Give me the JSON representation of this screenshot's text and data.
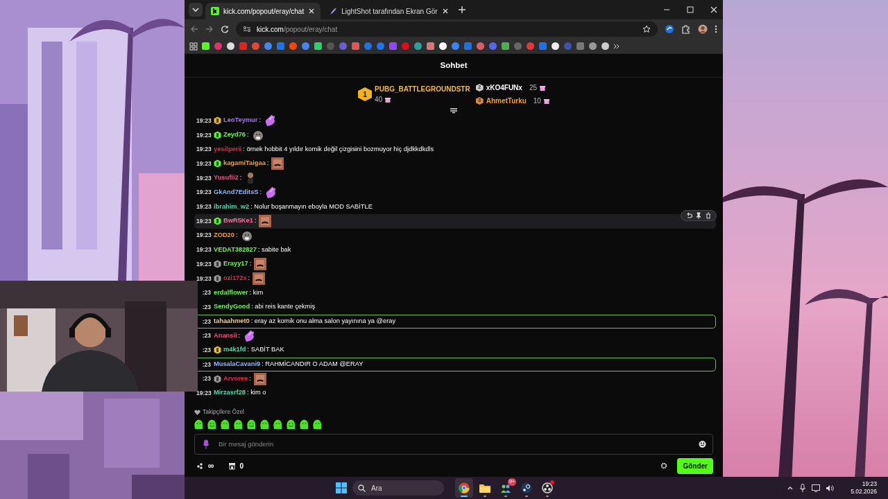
{
  "browser": {
    "tabs": [
      {
        "title": "kick.com/popout/eray/chat",
        "selected": true
      },
      {
        "title": "LightShot tarafından Ekran Gör",
        "selected": false
      }
    ],
    "address": {
      "host": "kick.com",
      "path": "/popout/eray/chat"
    }
  },
  "chat": {
    "title": "Sohbet",
    "leaderboard": [
      {
        "rank": "1",
        "user": "PUBG_BATTLEGROUNDSTR",
        "count": "40",
        "color": "#f5b94a"
      },
      {
        "rank": "2",
        "user": "xKO4FUNx",
        "count": "25",
        "color": "#ffffff"
      },
      {
        "rank": "3",
        "user": "AhmetTurku",
        "count": "10",
        "color": "#f59e2c"
      }
    ],
    "messages": [
      {
        "time": "19:23",
        "badge": {
          "kind": "gold"
        },
        "user": "LeoTeymur",
        "color": "#a970ff",
        "text": ":",
        "emote": {
          "kind": "hand"
        },
        "highlighted": false,
        "hovered": false
      },
      {
        "time": "19:23",
        "badge": {
          "kind": "green"
        },
        "user": "Zeyd76",
        "color": "#72f25b",
        "text": ":",
        "emote": {
          "kind": "seal"
        },
        "highlighted": false,
        "hovered": false
      },
      {
        "time": "19:23",
        "user": "yesilperii",
        "color": "#e0284b",
        "text": ": örnek hobbit 4 yıldır komik değil çizgisini bozmuyor hiç djdkkdkdls",
        "highlighted": false,
        "hovered": false
      },
      {
        "time": "19:23",
        "badge": {
          "kind": "green"
        },
        "user": "kagamiTaigaa",
        "color": "#f59e2c",
        "text": ":",
        "emote": {
          "kind": "face"
        },
        "highlighted": false,
        "hovered": false
      },
      {
        "time": "19:23",
        "user": "Yusufii2",
        "color": "#e05a8a",
        "text": ":",
        "emote": {
          "kind": "figure"
        },
        "highlighted": false,
        "hovered": false
      },
      {
        "time": "19:23",
        "user": "GkAnd7EditsS",
        "color": "#8fb4ff",
        "text": ":",
        "emote": {
          "kind": "hand"
        },
        "highlighted": false,
        "hovered": false
      },
      {
        "time": "19:23",
        "user": "ibrahim_w2",
        "color": "#5ad8b0",
        "text": ": Nolur boşanmayın eboyla MOD SABİTLE",
        "highlighted": false,
        "hovered": false
      },
      {
        "time": "19:23",
        "badge": {
          "kind": "green"
        },
        "user": "BwR5Ke1",
        "color": "#ff6b9a",
        "text": ":",
        "emote": {
          "kind": "face"
        },
        "highlighted": false,
        "hovered": true
      },
      {
        "time": "19:23",
        "user": "ZOD20",
        "color": "#f59e2c",
        "text": ":",
        "emote": {
          "kind": "seal"
        },
        "highlighted": false,
        "hovered": false
      },
      {
        "time": "19:23",
        "user": "VEDAT382827",
        "color": "#72f25b",
        "text": ": sabite bak",
        "highlighted": false,
        "hovered": false
      },
      {
        "time": "19:23",
        "badge": {
          "kind": "gray"
        },
        "user": "Erayy17",
        "color": "#72f25b",
        "text": ":",
        "emote": {
          "kind": "face"
        },
        "highlighted": false,
        "hovered": false
      },
      {
        "time": "19:23",
        "badge": {
          "kind": "gray"
        },
        "user": "ozi172x",
        "color": "#e0284b",
        "text": ":",
        "emote": {
          "kind": "face"
        },
        "highlighted": false,
        "hovered": false
      },
      {
        "time": ":23",
        "user": "erdalflower",
        "color": "#72f25b",
        "text": ": kim",
        "highlighted": false,
        "hovered": false
      },
      {
        "time": ":23",
        "user": "SendyGood",
        "color": "#72f25b",
        "text": ": abi reis kante çekmiş",
        "highlighted": false,
        "hovered": false
      },
      {
        "time": ":23",
        "user": "tahaahmet0",
        "color": "#f3c98b",
        "text": ": eray az komik onu alma salon yayınına ya @eray",
        "highlighted": true,
        "hovered": false
      },
      {
        "time": ":23",
        "user": "Anansii",
        "color": "#e8507a",
        "text": ":",
        "emote": {
          "kind": "hand"
        },
        "highlighted": false,
        "hovered": false
      },
      {
        "time": ":23",
        "badge": {
          "kind": "yellow"
        },
        "user": "m4k1fd",
        "color": "#5ad8b0",
        "text": ": SABİT BAK",
        "highlighted": false,
        "hovered": false
      },
      {
        "time": ":23",
        "user": "MusalaCavani9",
        "color": "#8fb4ff",
        "text": ": RAHMİCANDIR O ADAM @ERAY",
        "highlighted": true,
        "hovered": false
      },
      {
        "time": ":23",
        "badge": {
          "kind": "gray"
        },
        "user": "Arvoree",
        "color": "#e0284b",
        "text": ":",
        "emote": {
          "kind": "face"
        },
        "highlighted": false,
        "hovered": false
      },
      {
        "time": "19:23",
        "user": "Mirzasrf28",
        "color": "#5ad8b0",
        "text": ": kim o",
        "highlighted": false,
        "hovered": false
      }
    ],
    "followers_only_label": "Takipçilere Özel",
    "input": {
      "placeholder": "Bir mesaj gönderin"
    },
    "footer": {
      "points": "∞",
      "store_count": "0"
    },
    "send_button": "Gönder"
  },
  "taskbar": {
    "search_placeholder": "Ara",
    "apps": [
      {
        "kind": "browser",
        "selected": true,
        "notification": false
      },
      {
        "kind": "folder",
        "selected": false,
        "notification": false
      },
      {
        "kind": "team",
        "selected": false,
        "notification": false,
        "badge": "9+"
      },
      {
        "kind": "steam",
        "selected": false,
        "notification": false
      },
      {
        "kind": "recorder",
        "selected": false,
        "notification": true
      }
    ],
    "time": "19:23",
    "date": "5.02.2026"
  }
}
